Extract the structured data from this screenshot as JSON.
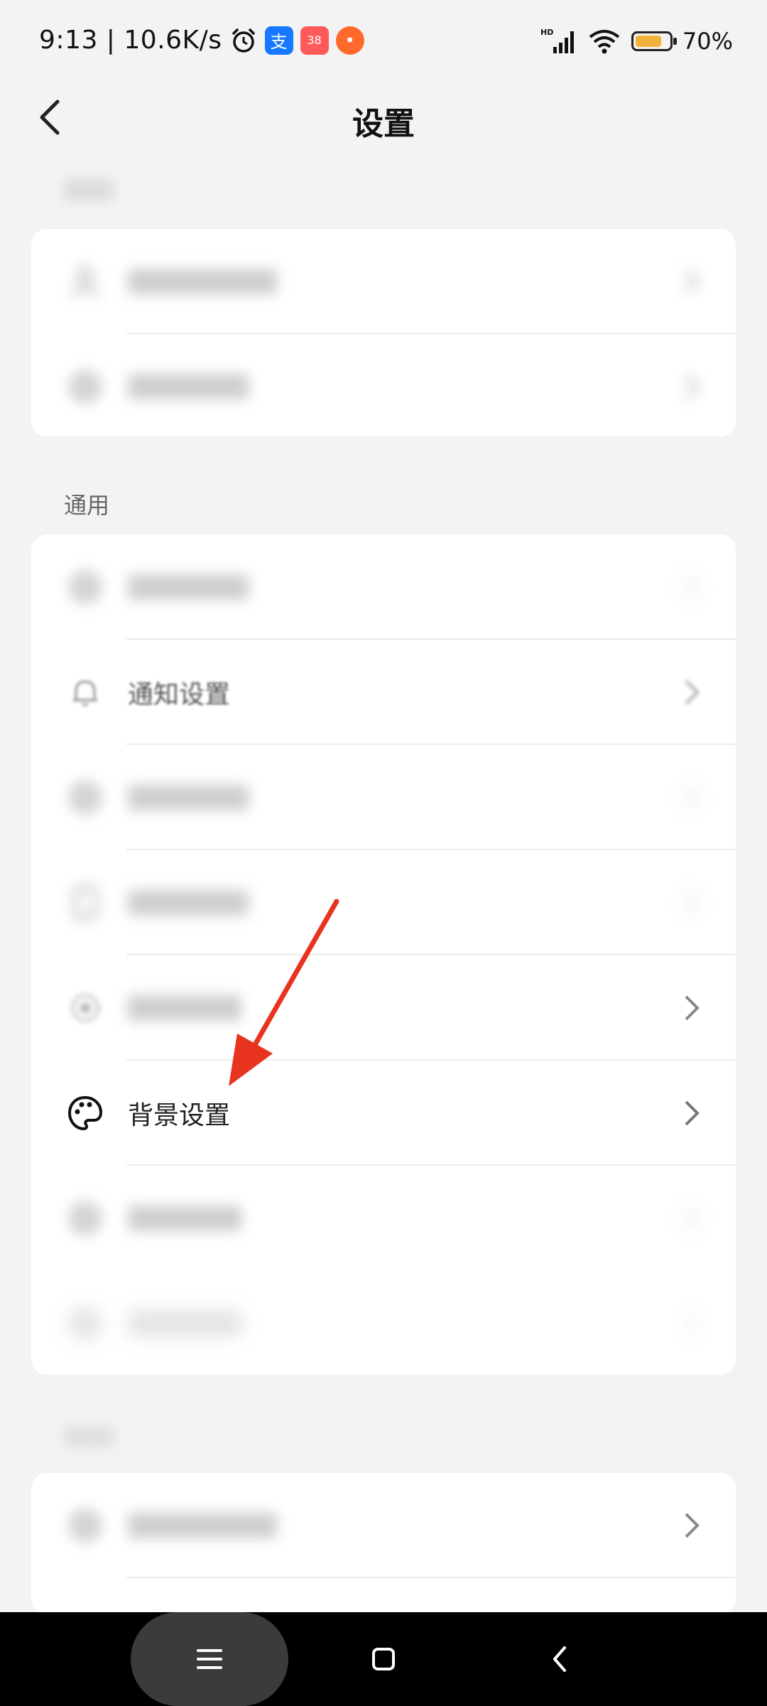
{
  "status_bar": {
    "time_speed": "9:13 | 10.6K/s",
    "badge_number": "38",
    "signal_label": "HD",
    "battery_text": "70%",
    "battery_level": 0.7,
    "icons": [
      "alarm-icon",
      "alipay-icon",
      "app-badge-icon",
      "orange-app-icon",
      "signal-icon",
      "wifi-icon",
      "battery-icon"
    ]
  },
  "header": {
    "title": "设置",
    "back_icon": "chevron-left-icon"
  },
  "sections": [
    {
      "title": "",
      "items": [
        {
          "label": ""
        },
        {
          "label": ""
        }
      ]
    },
    {
      "title": "通用",
      "items": [
        {
          "label": ""
        },
        {
          "label": "通知设置",
          "icon": "bell-icon"
        },
        {
          "label": ""
        },
        {
          "label": ""
        },
        {
          "label": ""
        },
        {
          "label": "背景设置",
          "icon": "palette-icon"
        },
        {
          "label": ""
        },
        {
          "label": ""
        }
      ]
    },
    {
      "title": "",
      "items": [
        {
          "label": ""
        },
        {
          "label": ""
        }
      ]
    }
  ],
  "annotation": {
    "type": "arrow",
    "color": "#e8331f"
  },
  "colors": {
    "accent_arrow": "#e8331f",
    "background": "#f3f3f3",
    "card": "#ffffff",
    "navbar": "#000000"
  },
  "nav_bar": {
    "icons": [
      "menu-icon",
      "home-icon",
      "back-icon"
    ]
  }
}
